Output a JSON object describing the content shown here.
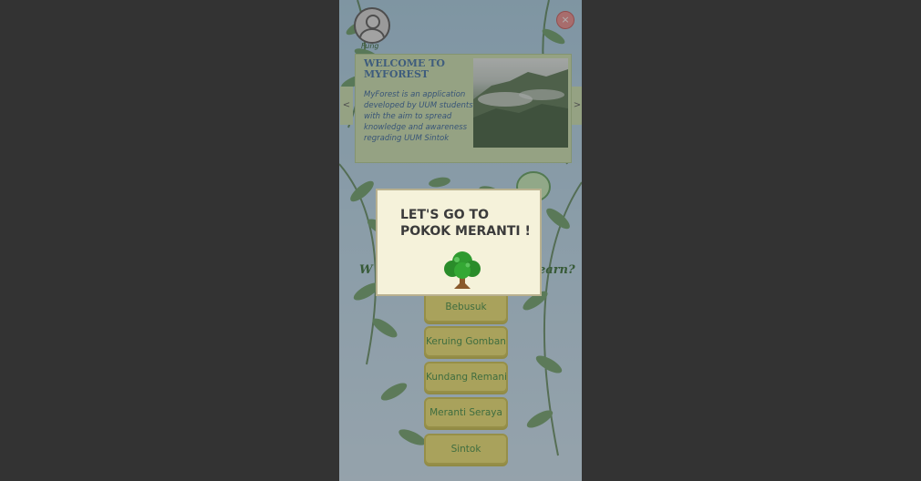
{
  "app": {
    "username": "Fung",
    "close_symbol": "×"
  },
  "welcome": {
    "title": "WELCOME TO MYFOREST",
    "description": "MyForest is an application developed by UUM students\nwith the aim to spread knowledge and awareness regrading UUM Sintok",
    "prev_arrow": "<",
    "next_arrow": ">"
  },
  "question": {
    "left_fragment": "W",
    "right_fragment": "earn?"
  },
  "tree_buttons": [
    {
      "label": "Bebusuk"
    },
    {
      "label": "Keruing Gombang"
    },
    {
      "label": "Kundang Remania"
    },
    {
      "label": "Meranti Seraya"
    },
    {
      "label": "Sintok"
    }
  ],
  "dialog": {
    "title": "LET'S GO TO POKOK MERANTI !"
  },
  "colors": {
    "overlay": "#464646",
    "button_bg": "#f1e66d",
    "button_text": "#3c8a3c",
    "card_bg": "#cfe6b0",
    "dialog_bg": "#f5f2da"
  },
  "icons": {
    "profile": "profile-icon",
    "close": "close-icon",
    "tree": "tree-icon"
  }
}
